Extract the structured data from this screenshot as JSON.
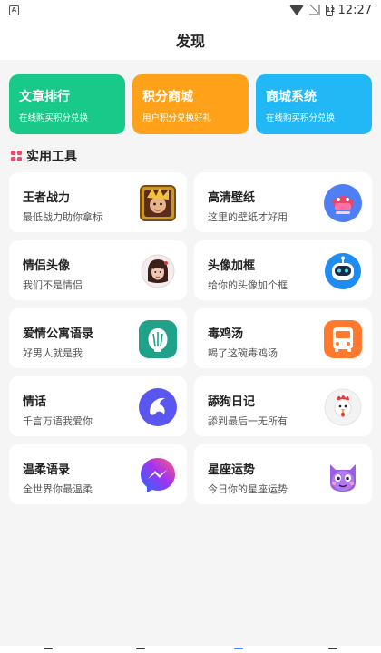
{
  "status_bar": {
    "notification_glyph": "A",
    "battery_level": "12",
    "time": "12:27"
  },
  "header": {
    "title": "发现"
  },
  "banners": [
    {
      "title": "文章排行",
      "subtitle": "在线购买积分兑换",
      "color": "#19c98a"
    },
    {
      "title": "积分商城",
      "subtitle": "用户积分兑换好礼",
      "color": "#ffa21a"
    },
    {
      "title": "商城系统",
      "subtitle": "在线购买积分兑换",
      "color": "#22b8f5"
    }
  ],
  "section": {
    "title": "实用工具",
    "icon": "grid-icon",
    "icon_color": "#f2476b"
  },
  "tools": [
    {
      "title": "王者战力",
      "subtitle": "最低战力助你拿标",
      "icon": "hero-avatar-icon"
    },
    {
      "title": "高清壁纸",
      "subtitle": "这里的壁纸才好用",
      "icon": "wallpaper-icon"
    },
    {
      "title": "情侣头像",
      "subtitle": "我们不是情侣",
      "icon": "couple-avatar-icon"
    },
    {
      "title": "头像加框",
      "subtitle": "给你的头像加个框",
      "icon": "robot-frame-icon"
    },
    {
      "title": "爱情公寓语录",
      "subtitle": "好男人就是我",
      "icon": "shell-icon"
    },
    {
      "title": "毒鸡汤",
      "subtitle": "喝了这碗毒鸡汤",
      "icon": "bus-icon"
    },
    {
      "title": "情话",
      "subtitle": "千言万语我爱你",
      "icon": "dolphin-icon"
    },
    {
      "title": "舔狗日记",
      "subtitle": "舔到最后一无所有",
      "icon": "rooster-icon"
    },
    {
      "title": "温柔语录",
      "subtitle": "全世界你最温柔",
      "icon": "messenger-icon"
    },
    {
      "title": "星座运势",
      "subtitle": "今日你的星座运势",
      "icon": "cat-monster-icon"
    }
  ]
}
